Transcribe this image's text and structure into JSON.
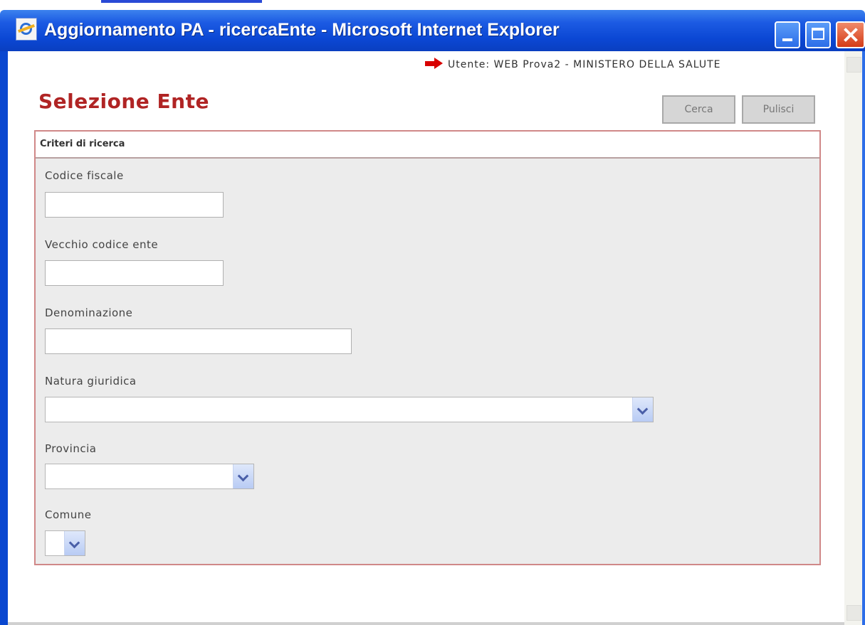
{
  "window": {
    "title": "Aggiornamento PA - ricercaEnte - Microsoft Internet Explorer"
  },
  "header": {
    "user_info": "Utente: WEB Prova2  - MINISTERO DELLA SALUTE",
    "page_title": "Selezione Ente",
    "search_button": "Cerca",
    "clear_button": "Pulisci"
  },
  "panel": {
    "title": "Criteri di ricerca",
    "fields": {
      "codice_fiscale": {
        "label": "Codice fiscale",
        "value": ""
      },
      "vecchio_codice": {
        "label": "Vecchio codice ente",
        "value": ""
      },
      "denominazione": {
        "label": "Denominazione",
        "value": ""
      },
      "natura_giuridica": {
        "label": "Natura giuridica",
        "selected": ""
      },
      "provincia": {
        "label": "Provincia",
        "selected": ""
      },
      "comune": {
        "label": "Comune",
        "selected": ""
      }
    }
  },
  "colors": {
    "title_red": "#b02424",
    "panel_border": "#d08888",
    "titlebar_blue": "#0b47d4",
    "arrow_red": "#d80000"
  },
  "icons": [
    "ie-icon",
    "minimize-icon",
    "maximize-icon",
    "close-icon",
    "red-arrow-icon",
    "chevron-down-icon"
  ]
}
